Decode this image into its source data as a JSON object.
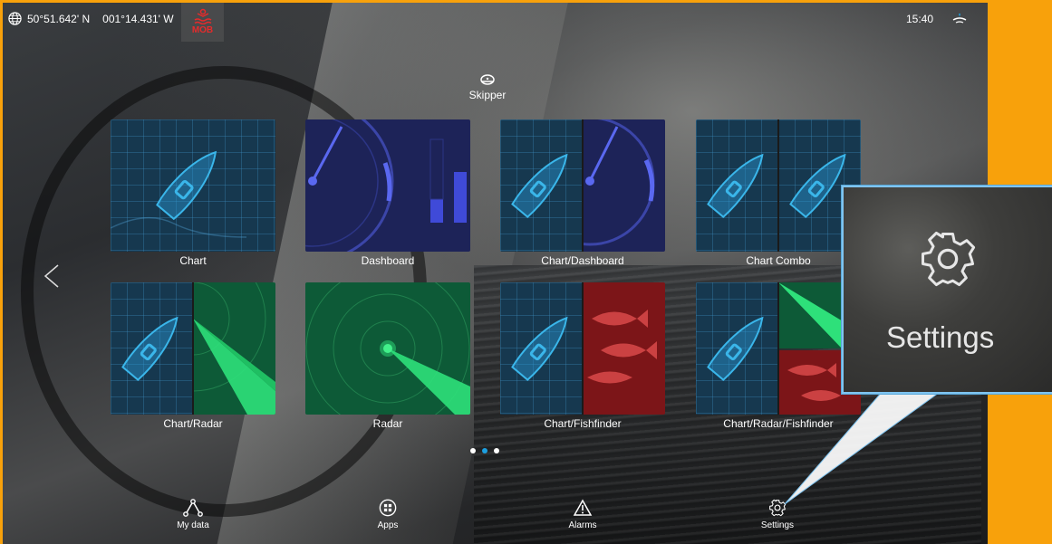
{
  "status": {
    "latitude": "50°51.642' N",
    "longitude": "001°14.431' W",
    "mob_label": "MOB",
    "time": "15:40"
  },
  "profile": {
    "name": "Skipper"
  },
  "apps": [
    {
      "label": "Chart"
    },
    {
      "label": "Dashboard"
    },
    {
      "label": "Chart/Dashboard"
    },
    {
      "label": "Chart Combo"
    },
    {
      "label": "Chart/Radar"
    },
    {
      "label": "Radar"
    },
    {
      "label": "Chart/Fishfinder"
    },
    {
      "label": "Chart/Radar/Fishfinder"
    }
  ],
  "pager": {
    "pages": 3,
    "active": 2
  },
  "bottom_nav": [
    {
      "label": "My data",
      "icon": "share-nodes-icon"
    },
    {
      "label": "Apps",
      "icon": "apps-grid-icon"
    },
    {
      "label": "Alarms",
      "icon": "warning-triangle-icon"
    },
    {
      "label": "Settings",
      "icon": "gear-icon"
    }
  ],
  "zoom_callout": {
    "label": "Settings"
  },
  "colors": {
    "frame": "#f8a10b",
    "mob": "#e52b2b",
    "accent": "#1c9fe0",
    "chart": "#16384f",
    "dashboard": "#1d2358",
    "radar": "#0d5a37",
    "fishfinder": "#7c1518"
  }
}
